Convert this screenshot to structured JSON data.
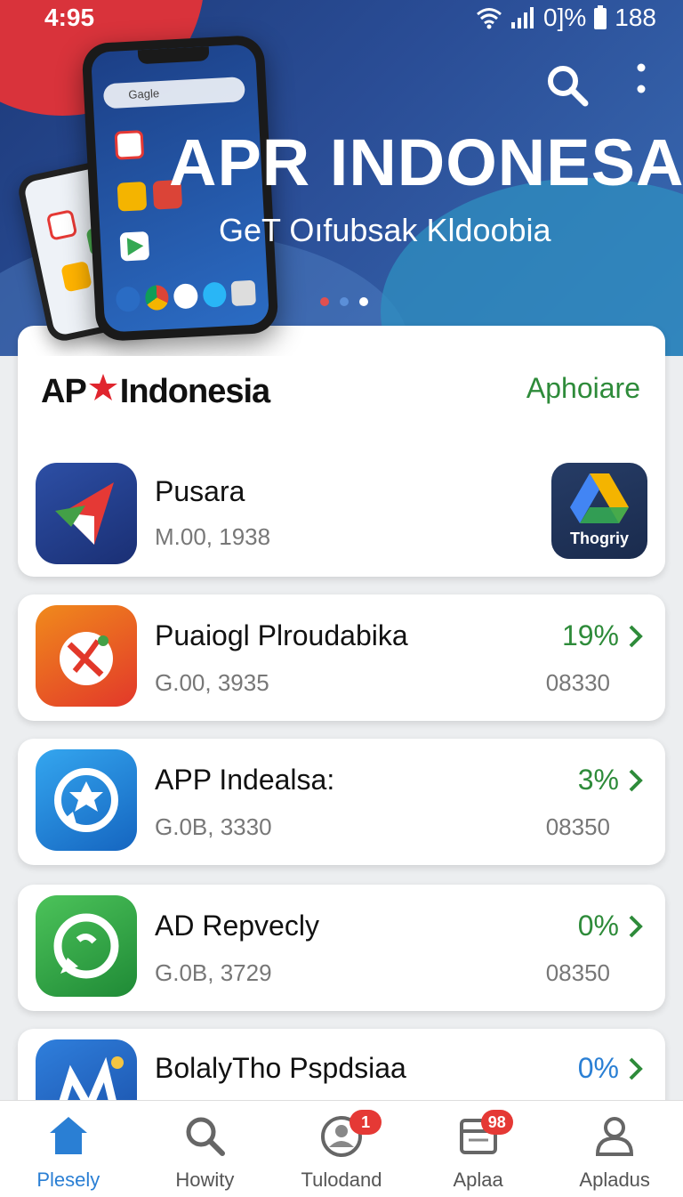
{
  "status_bar": {
    "time": "4:95",
    "battery_text": "0]%",
    "right_number": "188"
  },
  "hero": {
    "title": "APR INDONESA",
    "subtitle": "GeT Oıfubsak Kldoobia",
    "phone_search_text": "Gagle",
    "carousel_dot_colors": [
      "#e05050",
      "#5b8fd8",
      "#ffffff"
    ]
  },
  "featured": {
    "brand_left": "AP",
    "brand_right": "Indonesia",
    "link_label": "Aphoiare",
    "app": {
      "name": "Pusara",
      "meta": "M.00, 1938",
      "icon": "paper-plane-icon"
    },
    "tile_label": "Thogriy"
  },
  "apps": [
    {
      "name": "Puaiogl Plroudabika",
      "meta": "G.00, 3935",
      "meta_right": "08330",
      "percent": "19%",
      "percent_color": "#2e8b3a",
      "icon": "red-orange-app-icon"
    },
    {
      "name": "APP Indealsa:",
      "meta": "G.0B, 3330",
      "meta_right": "08350",
      "percent": "3%",
      "percent_color": "#2e8b3a",
      "icon": "blue-gear-app-icon"
    },
    {
      "name": "AD Repvecly",
      "meta": "G.0B, 3729",
      "meta_right": "08350",
      "percent": "0%",
      "percent_color": "#2e8b3a",
      "icon": "green-chat-app-icon"
    },
    {
      "name": "BolalyTho Pspdsiaa",
      "percent": "0%",
      "percent_color": "#2a7fd4",
      "icon": "blue-m-app-icon"
    }
  ],
  "nav": [
    {
      "label": "Plesely",
      "icon": "home-icon",
      "active": true
    },
    {
      "label": "Howity",
      "icon": "search-icon"
    },
    {
      "label": "Tulodand",
      "icon": "updates-icon",
      "badge": "1"
    },
    {
      "label": "Aplaa",
      "icon": "apps-icon",
      "badge": "98"
    },
    {
      "label": "Apladus",
      "icon": "profile-icon"
    }
  ]
}
